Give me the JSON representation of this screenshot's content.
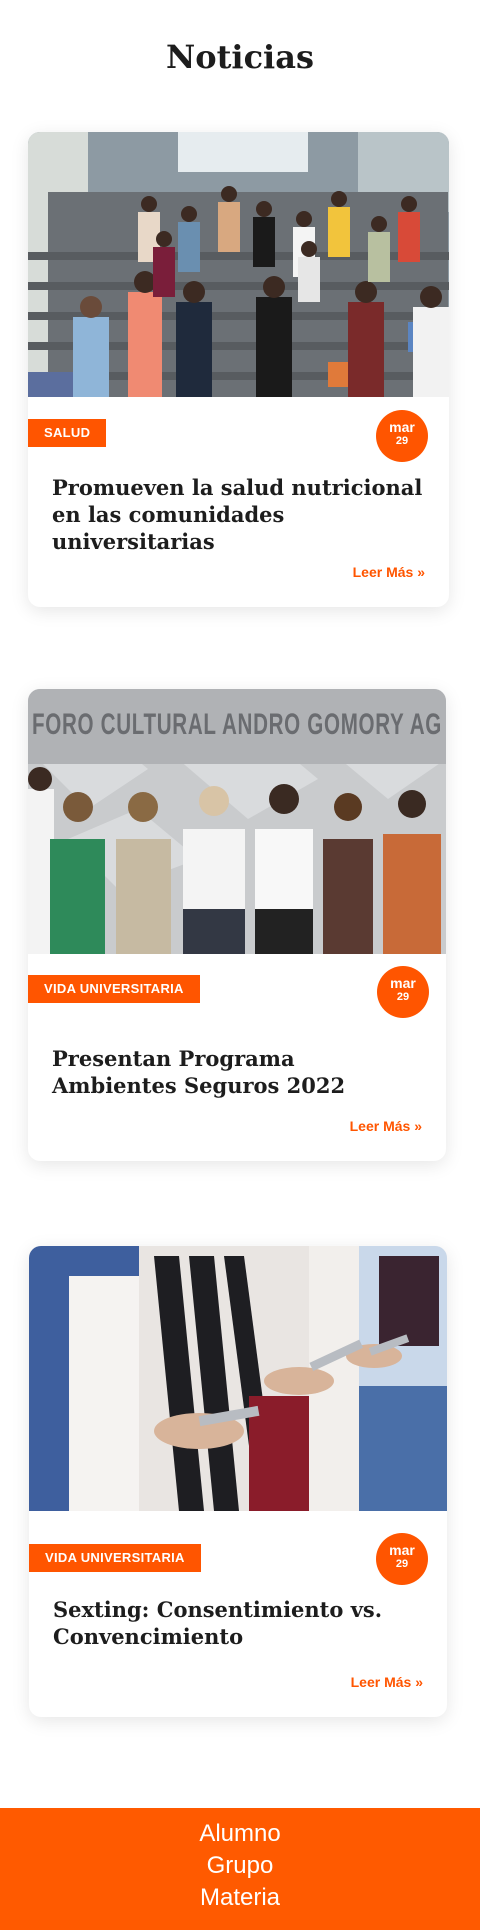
{
  "page": {
    "title": "Noticias"
  },
  "news": [
    {
      "category": "SALUD",
      "date_month": "mar",
      "date_day": "29",
      "title": "Promueven la salud nutricional en las comunidades universitarias",
      "read_more": "Leer Más »"
    },
    {
      "category": "VIDA UNIVERSITARIA",
      "date_month": "mar",
      "date_day": "29",
      "title": "Presentan Programa Ambientes Seguros 2022",
      "read_more": "Leer Más »",
      "image_sign": "FORO CULTURAL ANDRO GOMORY AG"
    },
    {
      "category": "VIDA UNIVERSITARIA",
      "date_month": "mar",
      "date_day": "29",
      "title": "Sexting: Consentimiento vs. Convencimiento",
      "read_more": "Leer Más »"
    }
  ],
  "footer": {
    "links": [
      "Alumno",
      "Grupo",
      "Materia"
    ]
  },
  "colors": {
    "accent": "#ff5500",
    "footer_bg": "#ff5a00",
    "title_text": "#1d1d1d"
  }
}
